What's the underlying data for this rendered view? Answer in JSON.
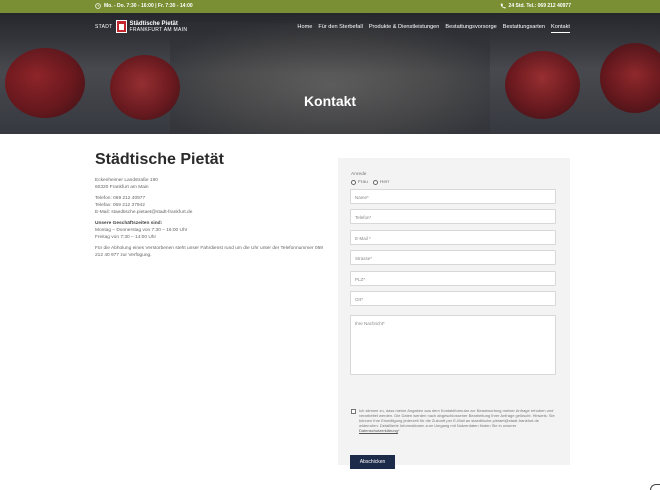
{
  "topbar": {
    "hours": "Mo. - Do. 7:30 - 16:00 | Fr. 7:30 - 14:00",
    "phone": "24 Std. Tel.: 069 212 40977",
    "color": "#7a8f33"
  },
  "logo": {
    "stadt": "STADT",
    "name1": "Städtische Pietät",
    "name2": "FRANKFURT AM MAIN"
  },
  "nav": {
    "items": [
      "Home",
      "Für den Sterbefall",
      "Produkte & Dienstleistungen",
      "Bestattungsvorsorge",
      "Bestattungsarten",
      "Kontakt"
    ]
  },
  "hero": {
    "title": "Kontakt"
  },
  "info": {
    "heading": "Städtische Pietät",
    "address1": "Eckenheimer Landstraße 190",
    "address2": "60320 Frankfurt am Main",
    "phone": "Telefon: 069 212 40977",
    "fax": "Telefax: 069 212 37942",
    "email": "E-Mail: staedtische.pietaet@stadt-frankfurt.de",
    "hours_title": "Unsere Geschäftszeiten sind:",
    "hours1": "Montag – Donnerstag von 7:30 – 16:00 Uhr",
    "hours2": "Freitag von 7:30 – 14:00 Uhr",
    "note": "Für die Abholung eines Verstorbenen steht unser Fahrdienst rund um die Uhr unter der Telefonnummer 069 212 40 977 zur Verfügung."
  },
  "form": {
    "anrede_label": "Anrede",
    "radio_frau": "Frau",
    "radio_herr": "Herr",
    "name": "Name*",
    "telefon": "Telefon*",
    "email": "E-Mail *",
    "strasse": "Strasse*",
    "plz": "PLZ*",
    "ort": "Ort*",
    "message": "Ihre Nachricht*",
    "consent_text": "Ich stimme zu, dass meine Angaben aus dem Kontaktformular zur Beantwortung meiner Anfrage erhoben und verarbeitet werden. Die Daten werden nach abgeschlossener Bearbeitung Ihrer Anfrage gelöscht. Hinweis: Sie können Ihre Einwilligung jederzeit für die Zukunft per E-Mail an staedtische.pietaet@stadt-frankfurt.de widerrufen. Detaillierte Informationen zum Umgang mit Nutzerdaten finden Sie in unserer ",
    "consent_link": "Datenschutzerklärung",
    "consent_end": "*",
    "submit": "Abschicken"
  }
}
